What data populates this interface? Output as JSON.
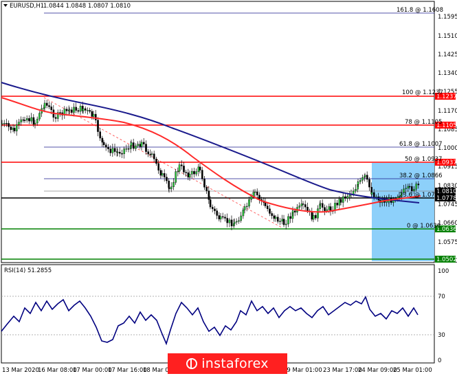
{
  "header": {
    "symbol": "EURUSD,H1",
    "ohlc": "1.0844 1.0848 1.0807 1.0810",
    "rsi_label": "RSI(14) 51.2855"
  },
  "price_axis": [
    "1.1595",
    "1.1510",
    "1.1425",
    "1.1340",
    "1.1255",
    "1.1170",
    "1.1085",
    "1.1000",
    "1.0915",
    "1.0830",
    "1.0745",
    "1.0660",
    "1.0575",
    "1.0490"
  ],
  "rsi_axis": [
    "100",
    "70",
    "30",
    "0"
  ],
  "time_axis": [
    "13 Mar 2020",
    "16 Mar 08:00",
    "17 Mar 00:00",
    "17 Mar 16:00",
    "18 Mar 08",
    "19 Mar 01:00",
    "23 Mar 17:00",
    "24 Mar 09:00",
    "25 Mar 01:00"
  ],
  "fib_labels": [
    "161.8 @ 1.1608",
    "100 @ 1.1237",
    "78 @ 1.1105",
    "61.8 @ 1.1007",
    "50 @ 1.0937",
    "38.2 @ 1.0866",
    "23.6 @ 1.0778",
    "0 @ 1.0636"
  ],
  "price_tags": {
    "a": "1.1237",
    "b": "1.1105",
    "c": "1.0937",
    "d": "1.0810",
    "e": "1.0778",
    "f": "1.0636",
    "g": "1.0502"
  },
  "logo": "instaforex",
  "colors": {
    "support_resistance": "#ff0000",
    "green_level": "#008000",
    "ma_fast": "#ff2a2a",
    "ma_slow": "#1a1a8c",
    "bull_candle": "#2ecc40",
    "bear_candle": "#000000",
    "rsi_line": "#000080",
    "highlight": "#87cefa"
  }
}
